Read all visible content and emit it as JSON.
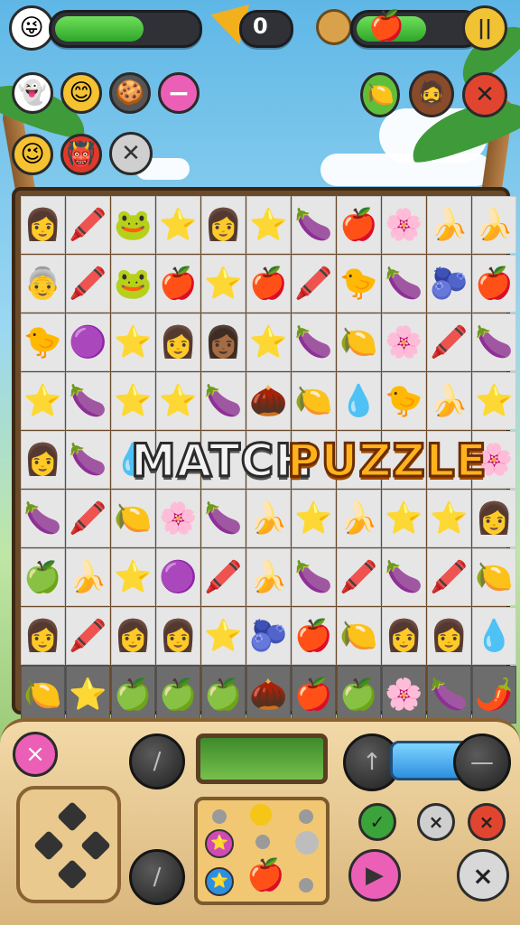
{
  "hud": {
    "score": "0",
    "health_progress": 0.6,
    "bonus_progress": 0.55,
    "pause_icon": "pause-icon",
    "score_icon": "triangle-gem-icon",
    "colors": {
      "bar_fill": "#3bbd34",
      "pause": "#f1c232",
      "close": "#e2452f"
    }
  },
  "characters_left": [
    "ghost",
    "smiley",
    "cookie",
    "minus",
    "winking",
    "spiky-red",
    "close"
  ],
  "characters_right": [
    "lemon",
    "caveman",
    "close"
  ],
  "title": {
    "word1": "MATCH",
    "word2": "PUZZLE"
  },
  "board": {
    "rows": [
      [
        "👩",
        "🖍️",
        "🐸",
        "⭐",
        "👩",
        "⭐",
        "🍆",
        "🍎",
        "🌸",
        "🍌",
        "🍌"
      ],
      [
        "👵",
        "🖍️",
        "🐸",
        "🍎",
        "⭐",
        "🍎",
        "🖍️",
        "🐤",
        "🍆",
        "🫐",
        "🍎"
      ],
      [
        "🐤",
        "🟣",
        "⭐",
        "👩",
        "👩🏾",
        "⭐",
        "🍆",
        "🍋",
        "🌸",
        "🖍️",
        "🍆"
      ],
      [
        "⭐",
        "🍆",
        "⭐",
        "⭐",
        "🍆",
        "🌰",
        "🍋",
        "💧",
        "🐤",
        "🍌",
        "⭐"
      ],
      [
        "👩",
        "🍆",
        "💧",
        "",
        "",
        "",
        "",
        "",
        "",
        "",
        "🌸"
      ],
      [
        "🍆",
        "🖍️",
        "🍋",
        "🌸",
        "🍆",
        "🍌",
        "⭐",
        "🍌",
        "⭐",
        "⭐",
        "👩"
      ],
      [
        "🍏",
        "🍌",
        "⭐",
        "🟣",
        "🖍️",
        "🍌",
        "🍆",
        "🖍️",
        "🍆",
        "🖍️",
        "🍋"
      ],
      [
        "👩",
        "🖍️",
        "👩",
        "👩",
        "⭐",
        "🫐",
        "🍎",
        "🍋",
        "👩",
        "👩",
        "💧"
      ],
      [
        "🍋",
        "⭐",
        "🍏",
        "🍏",
        "🍏",
        "🌰",
        "🍎",
        "🍏",
        "🌸",
        "🍆",
        "🌶️"
      ]
    ]
  },
  "controls": {
    "pink_close": "×",
    "play": "▶",
    "right_buttons": [
      "✓",
      "×",
      "×",
      "×"
    ]
  }
}
